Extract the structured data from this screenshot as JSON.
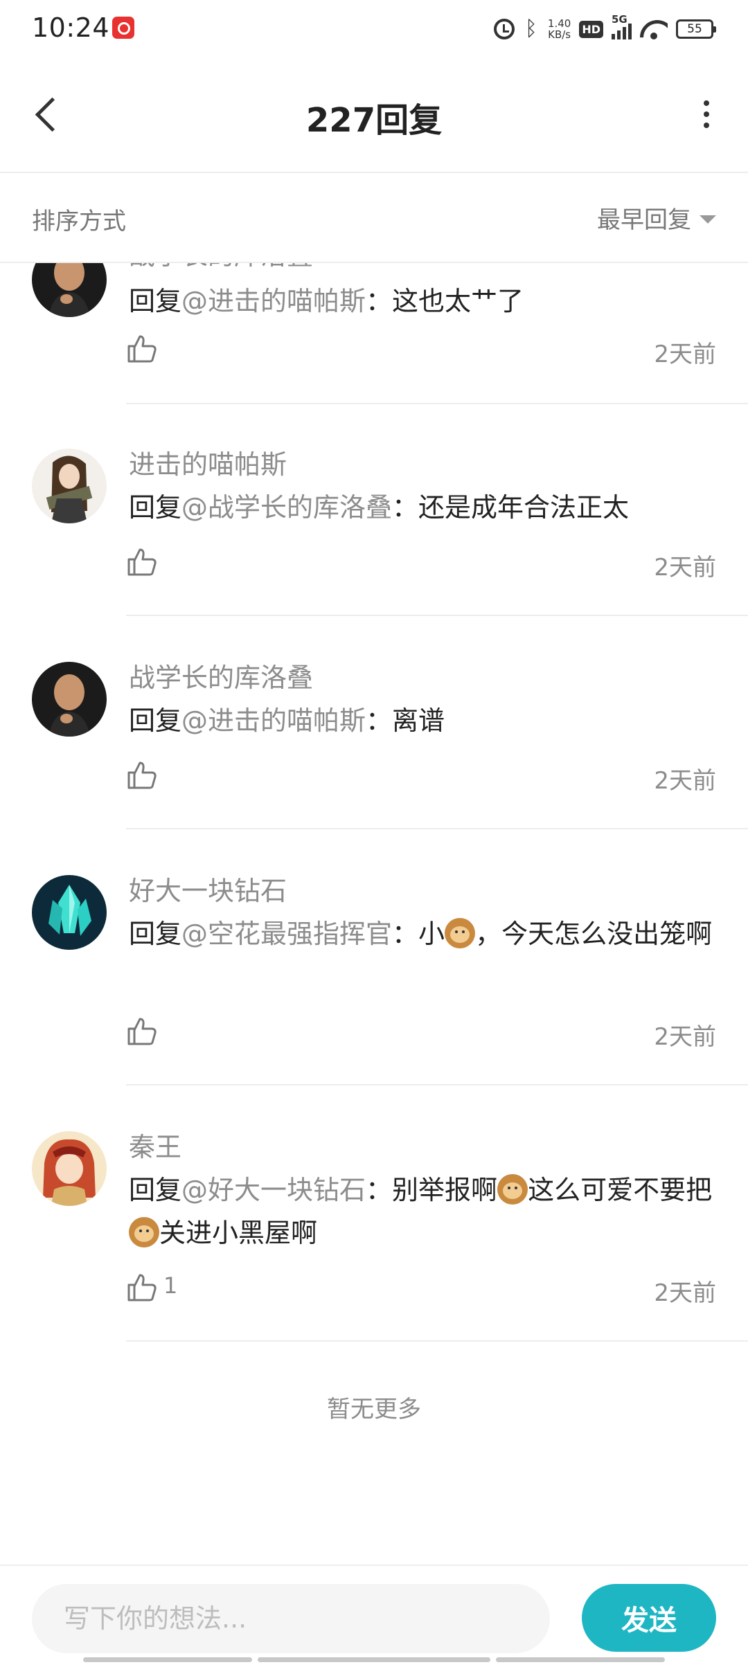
{
  "status_bar": {
    "time": "10:24",
    "speed_value": "1.40",
    "speed_unit": "KB/s",
    "hd": "HD",
    "network": "5G",
    "battery": "55"
  },
  "header": {
    "title": "227回复"
  },
  "sort": {
    "label": "排序方式",
    "selected": "最早回复"
  },
  "replies": [
    {
      "username": "战学长的库洛叠",
      "reply_prefix": "回复",
      "mention": "@进击的喵帕斯",
      "separator": "：",
      "text": "这也太艹了",
      "time": "2天前",
      "likes": ""
    },
    {
      "username": "进击的喵帕斯",
      "reply_prefix": "回复",
      "mention": "@战学长的库洛叠",
      "separator": "：",
      "text": "还是成年合法正太",
      "time": "2天前",
      "likes": ""
    },
    {
      "username": "战学长的库洛叠",
      "reply_prefix": "回复",
      "mention": "@进击的喵帕斯",
      "separator": "：",
      "text": "离谱",
      "time": "2天前",
      "likes": ""
    },
    {
      "username": "好大一块钻石",
      "reply_prefix": "回复",
      "mention": "@空花最强指挥官",
      "separator": "：",
      "text_a": "小",
      "text_b": "，今天怎么没出笼啊",
      "time": "2天前",
      "likes": ""
    },
    {
      "username": "秦王",
      "reply_prefix": "回复",
      "mention": "@好大一块钻石",
      "separator": "：",
      "text_a": "别举报啊",
      "text_b": "这么可爱不要把",
      "text_c": "关进小黑屋啊",
      "time": "2天前",
      "likes": "1"
    }
  ],
  "footer_note": "暂无更多",
  "composer": {
    "placeholder": "写下你的想法...",
    "send_label": "发送"
  },
  "colors": {
    "accent": "#1fb6c4",
    "muted_text": "#8c8c8c",
    "divider": "#ededed"
  }
}
